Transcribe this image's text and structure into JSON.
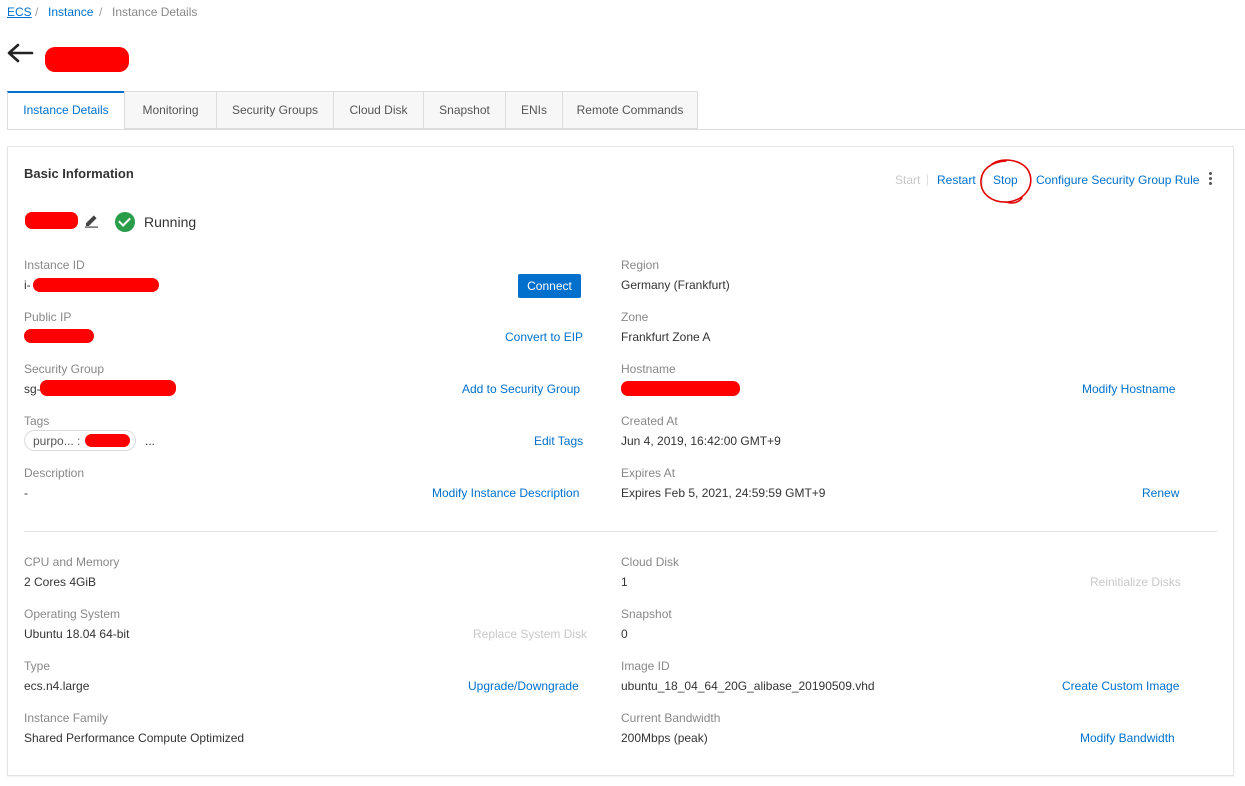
{
  "breadcrumb": {
    "items": [
      "ECS",
      "Instance",
      "Instance Details"
    ],
    "separator": "/"
  },
  "header": {
    "back_icon": "arrow-left-icon",
    "title_redacted": true
  },
  "tabs": [
    {
      "label": "Instance Details",
      "active": true
    },
    {
      "label": "Monitoring",
      "active": false
    },
    {
      "label": "Security Groups",
      "active": false
    },
    {
      "label": "Cloud Disk",
      "active": false
    },
    {
      "label": "Snapshot",
      "active": false
    },
    {
      "label": "ENIs",
      "active": false
    },
    {
      "label": "Remote Commands",
      "active": false
    }
  ],
  "basic_info": {
    "title": "Basic Information",
    "actions": {
      "start": "Start",
      "restart": "Restart",
      "stop": "Stop",
      "configure": "Configure Security Group Rule",
      "more_icon": "more-vertical-icon"
    },
    "edit_icon": "pencil-icon",
    "status": "Running",
    "status_icon": "check-circle-icon",
    "left_fields": {
      "instance_id": {
        "label": "Instance ID",
        "value_prefix": "i-",
        "action": "Connect"
      },
      "public_ip": {
        "label": "Public IP",
        "action": "Convert to EIP"
      },
      "security_group": {
        "label": "Security Group",
        "value_prefix": "sg-",
        "action": "Add to Security Group"
      },
      "tags": {
        "label": "Tags",
        "tag_key": "purpo... :",
        "more": "...",
        "action": "Edit Tags"
      },
      "description": {
        "label": "Description",
        "value": "-",
        "action": "Modify Instance Description"
      }
    },
    "right_fields": {
      "region": {
        "label": "Region",
        "value": "Germany (Frankfurt)"
      },
      "zone": {
        "label": "Zone",
        "value": "Frankfurt Zone A"
      },
      "hostname": {
        "label": "Hostname",
        "action": "Modify Hostname"
      },
      "created_at": {
        "label": "Created At",
        "value": "Jun 4, 2019, 16:42:00 GMT+9"
      },
      "expires_at": {
        "label": "Expires At",
        "value": "Expires Feb 5, 2021, 24:59:59 GMT+9",
        "action": "Renew"
      }
    }
  },
  "config": {
    "left_fields": {
      "cpu_memory": {
        "label": "CPU and Memory",
        "value": "2 Cores 4GiB"
      },
      "os": {
        "label": "Operating System",
        "value": "Ubuntu 18.04 64-bit",
        "action": "Replace System Disk"
      },
      "type": {
        "label": "Type",
        "value": "ecs.n4.large",
        "action": "Upgrade/Downgrade"
      },
      "family": {
        "label": "Instance Family",
        "value": "Shared Performance Compute Optimized"
      }
    },
    "right_fields": {
      "cloud_disk": {
        "label": "Cloud Disk",
        "value": "1",
        "action": "Reinitialize Disks"
      },
      "snapshot": {
        "label": "Snapshot",
        "value": "0"
      },
      "image_id": {
        "label": "Image ID",
        "value": "ubuntu_18_04_64_20G_alibase_20190509.vhd",
        "action": "Create Custom Image"
      },
      "bandwidth": {
        "label": "Current Bandwidth",
        "value": "200Mbps (peak)",
        "action": "Modify Bandwidth"
      }
    }
  },
  "colors": {
    "link": "#0070cc",
    "running": "#2a9d4a",
    "redaction": "#ff0000",
    "annotation": "#e00000"
  }
}
